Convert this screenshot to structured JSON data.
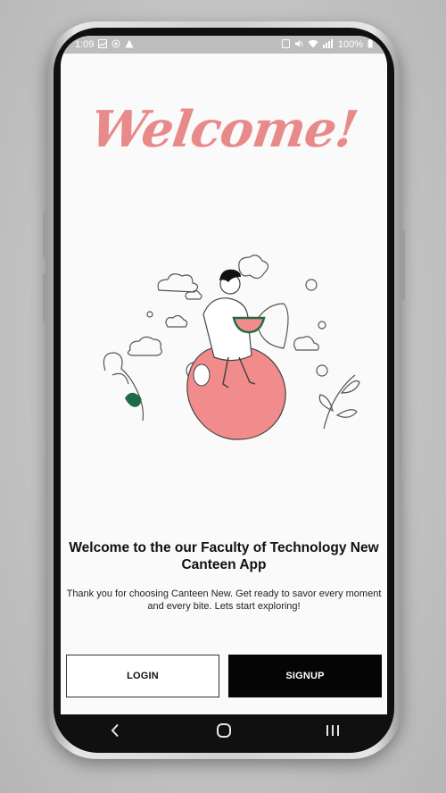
{
  "status_bar": {
    "time": "1:09",
    "battery": "100%"
  },
  "screen": {
    "title": "Welcome!",
    "heading": "Welcome to the our Faculty of Technology New Canteen App",
    "subtext": "Thank you for choosing Canteen New. Get ready to savor every moment and every bite. Lets start exploring!",
    "login_label": "LOGIN",
    "signup_label": "SIGNUP"
  },
  "colors": {
    "accent_pink": "#e88a8a",
    "apple": "#f28b8b",
    "leaf_green": "#1f6b45",
    "button_dark": "#050505"
  },
  "nav_bar": {
    "icons": [
      "back-icon",
      "home-icon",
      "recents-icon"
    ]
  }
}
